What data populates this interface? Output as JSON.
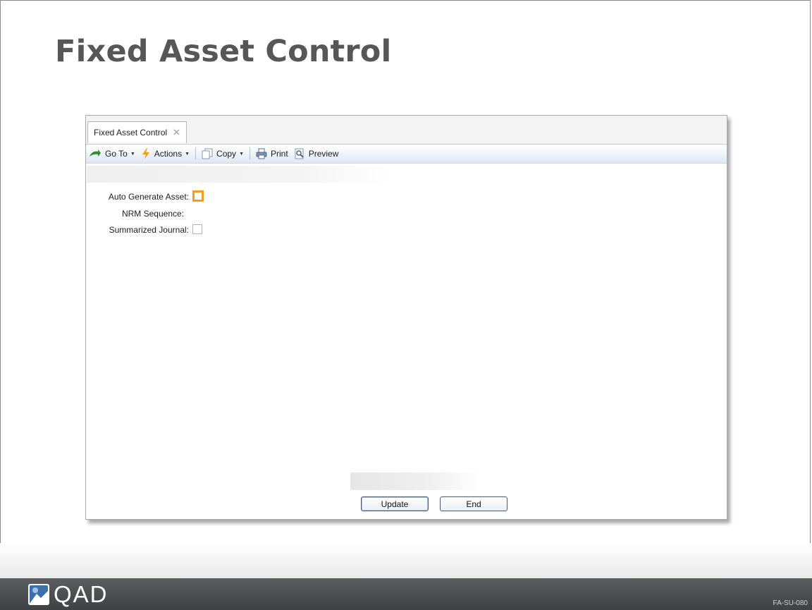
{
  "slide": {
    "title": "Fixed Asset Control",
    "logo_text": "QAD",
    "slide_code": "FA-SU-080"
  },
  "window": {
    "tab_label": "Fixed Asset Control",
    "tab_close_glyph": "✕",
    "toolbar": {
      "goto_label": "Go To",
      "actions_label": "Actions",
      "copy_label": "Copy",
      "print_label": "Print",
      "preview_label": "Preview",
      "dropdown_glyph": "▼"
    },
    "form": {
      "auto_generate_asset_label": "Auto Generate Asset:",
      "nrm_sequence_label": "NRM Sequence:",
      "summarized_journal_label": "Summarized Journal:",
      "auto_generate_asset_checked": false,
      "summarized_journal_checked": false
    },
    "buttons": {
      "update_label": "Update",
      "end_label": "End"
    }
  },
  "colors": {
    "focus_orange": "#f0a01c",
    "footer_dark": "#4a4c4f",
    "title_gray": "#575757"
  },
  "icons": [
    "goto-icon",
    "actions-icon",
    "copy-icon",
    "print-icon",
    "preview-icon",
    "qad-logo-icon"
  ]
}
